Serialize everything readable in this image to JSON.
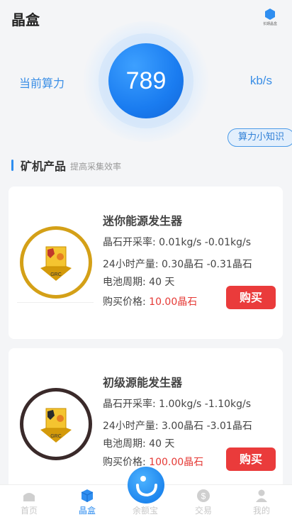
{
  "header": {
    "title": "晶盒",
    "icon_caption": "长期晶盒"
  },
  "hashrate": {
    "label": "当前算力",
    "value": "789",
    "unit": "kb/s"
  },
  "knowledge_button": "算力小知识",
  "section": {
    "title": "矿机产品",
    "subtitle": "提高采集效率"
  },
  "products": [
    {
      "name": "迷你能源发生器",
      "rate": "晶石开采率: 0.01kg/s -0.01kg/s",
      "output": "24小时产量: 0.30晶石 -0.31晶石",
      "cycle": "电池周期: 40 天",
      "price_label": "购买价格: ",
      "price": "10.00晶石",
      "buy": "购买",
      "logo_text": "GRC",
      "ring_color": "#d4a017"
    },
    {
      "name": "初级源能发生器",
      "rate": "晶石开采率: 1.00kg/s -1.10kg/s",
      "output": "24小时产量: 3.00晶石 -3.01晶石",
      "cycle": "电池周期: 40 天",
      "price_label": "购买价格: ",
      "price": "100.00晶石",
      "buy": "购买",
      "logo_text": "GRC",
      "ring_color": "#3a2a2a"
    }
  ],
  "tabs": [
    {
      "label": "首页",
      "icon": "home-icon",
      "active": false
    },
    {
      "label": "晶盒",
      "icon": "box-icon",
      "active": true
    },
    {
      "label": "余额宝",
      "icon": "yuebao-icon",
      "active": false
    },
    {
      "label": "交易",
      "icon": "dollar-icon",
      "active": false
    },
    {
      "label": "我的",
      "icon": "user-icon",
      "active": false
    }
  ],
  "colors": {
    "accent": "#2f8ef0",
    "buy": "#ea3b3b",
    "price": "#e53935"
  }
}
